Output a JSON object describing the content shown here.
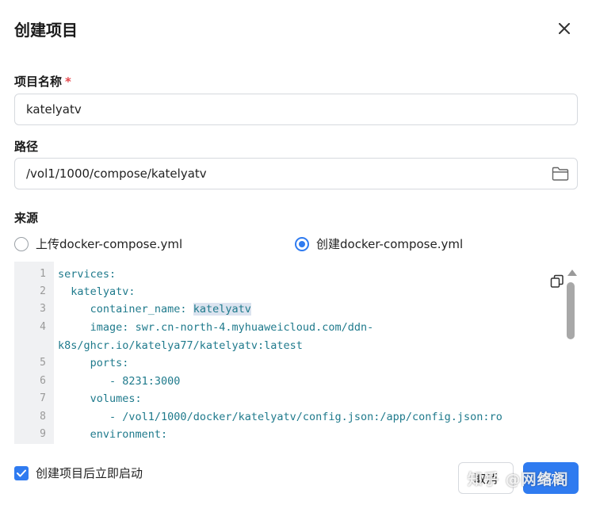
{
  "dialog": {
    "title": "创建项目",
    "close_icon": "close-icon"
  },
  "fields": {
    "name_label": "项目名称",
    "required_mark": "*",
    "name_value": "katelyatv",
    "path_label": "路径",
    "path_value": "/vol1/1000/compose/katelyatv",
    "path_icon": "folder-icon",
    "source_label": "来源"
  },
  "source_options": [
    {
      "label": "上传docker-compose.yml",
      "selected": false
    },
    {
      "label": "创建docker-compose.yml",
      "selected": true
    }
  ],
  "editor": {
    "line_numbers": [
      "1",
      "2",
      "3",
      "4",
      "",
      "5",
      "6",
      "7",
      "8",
      "9"
    ],
    "lines": [
      {
        "indent": "",
        "key": "services:",
        "value": ""
      },
      {
        "indent": "  ",
        "key": "katelyatv:",
        "value": ""
      },
      {
        "indent": "     ",
        "key": "container_name:",
        "value": "katelyatv"
      },
      {
        "indent": "     ",
        "key": "image:",
        "value": "swr.cn-north-4.myhuaweicloud.com/ddn-"
      },
      {
        "indent": "",
        "key": "",
        "value": "k8s/ghcr.io/katelya77/katelyatv:latest"
      },
      {
        "indent": "     ",
        "key": "ports:",
        "value": ""
      },
      {
        "indent": "        ",
        "key": "",
        "value": "- 8231:3000"
      },
      {
        "indent": "     ",
        "key": "volumes:",
        "value": ""
      },
      {
        "indent": "        ",
        "key": "",
        "value": "- /vol1/1000/docker/katelyatv/config.json:/app/config.json:ro"
      },
      {
        "indent": "     ",
        "key": "environment:",
        "value": ""
      }
    ],
    "copy_icon": "copy-icon"
  },
  "footer": {
    "autostart_label": "创建项目后立即启动",
    "autostart_checked": true,
    "cancel_label": "取消",
    "confirm_label": "确定",
    "watermark": "知乎 @网络阁"
  },
  "colors": {
    "accent": "#2f7bf0",
    "code_text": "#1f7a8c",
    "gutter_bg": "#f0f1f3"
  }
}
